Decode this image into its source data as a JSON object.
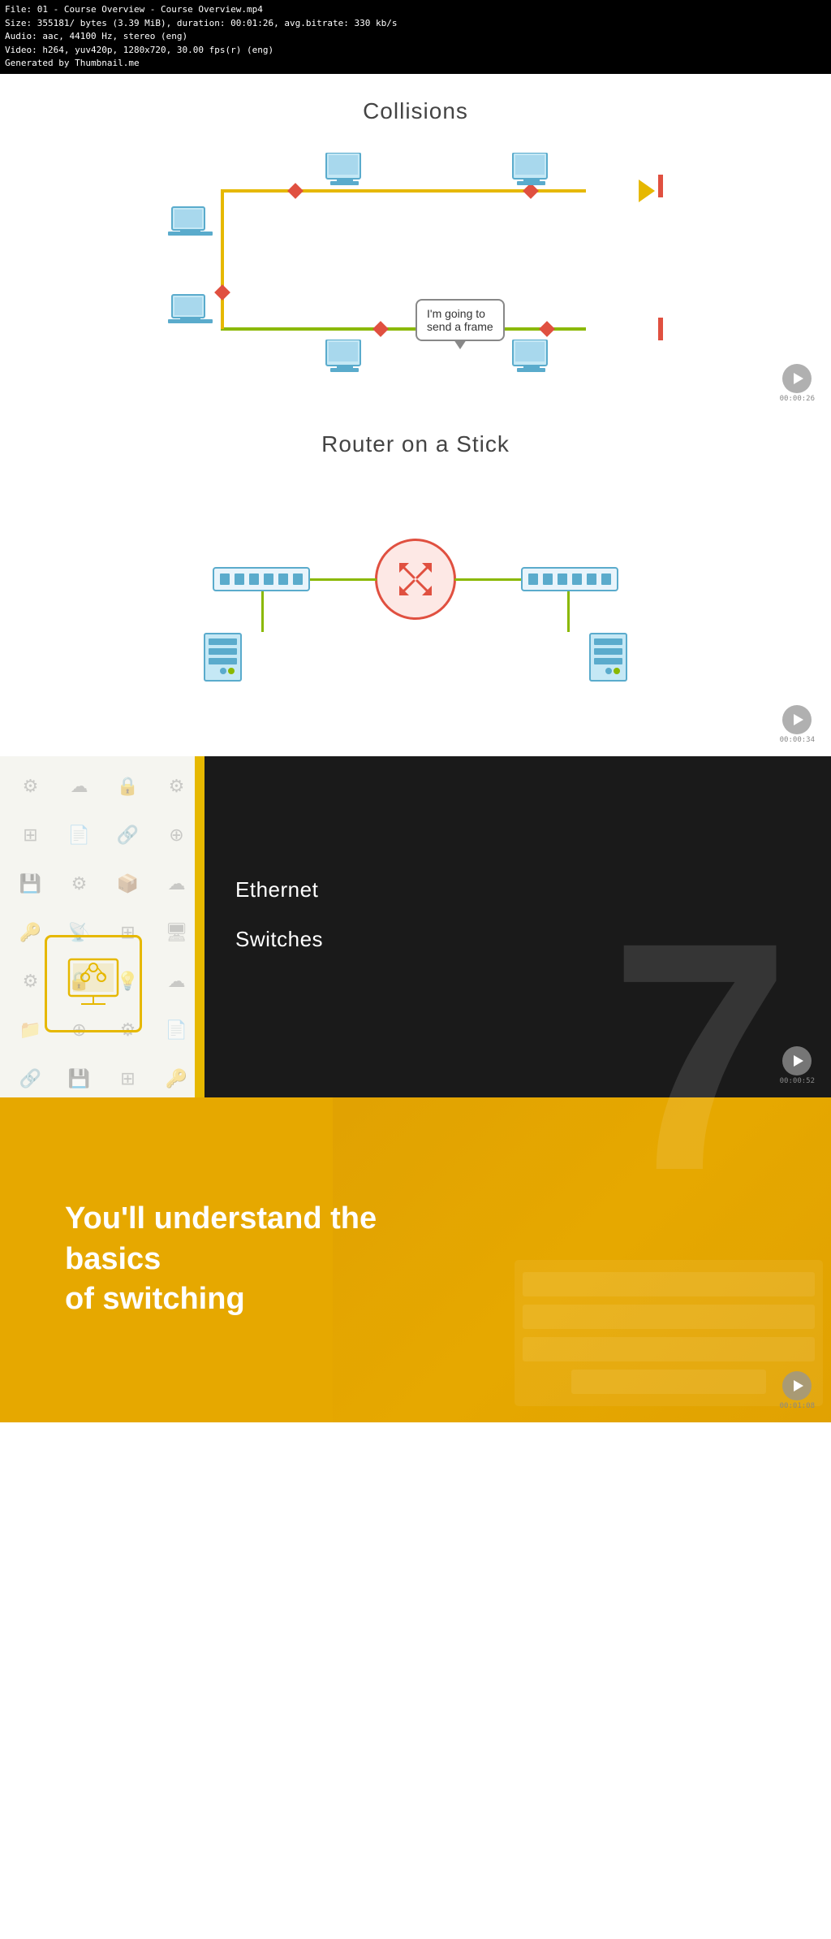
{
  "metadata": {
    "line1": "File: 01 - Course Overview - Course Overview.mp4",
    "line2": "Size: 355181/ bytes (3.39 MiB), duration: 00:01:26, avg.bitrate: 330 kb/s",
    "line3": "Audio: aac, 44100 Hz, stereo (eng)",
    "line4": "Video: h264, yuv420p, 1280x720, 30.00 fps(r) (eng)",
    "line5": "Generated by Thumbnail.me"
  },
  "section1": {
    "title": "Collisions",
    "timestamp": "00:00:26",
    "speech_bubble_line1": "I'm going to",
    "speech_bubble_line2": "send a frame"
  },
  "section2": {
    "title": "Router on a Stick",
    "timestamp": "00:00:34"
  },
  "section3": {
    "ethernet_label": "Ethernet",
    "switches_label": "Switches",
    "timestamp": "00:00:52"
  },
  "section4": {
    "goal_line1": "You'll understand the basics",
    "goal_line2": "of switching",
    "timestamp": "00:01:08",
    "bg_number": "7"
  },
  "icons": {
    "play": "▶",
    "expand": "⤢",
    "gear": "⚙",
    "lock": "🔒",
    "network": "⊞",
    "cloud": "☁",
    "database": "🗄",
    "code": "</>",
    "monitor": "🖥",
    "settings": "⚙",
    "key": "🔑"
  }
}
